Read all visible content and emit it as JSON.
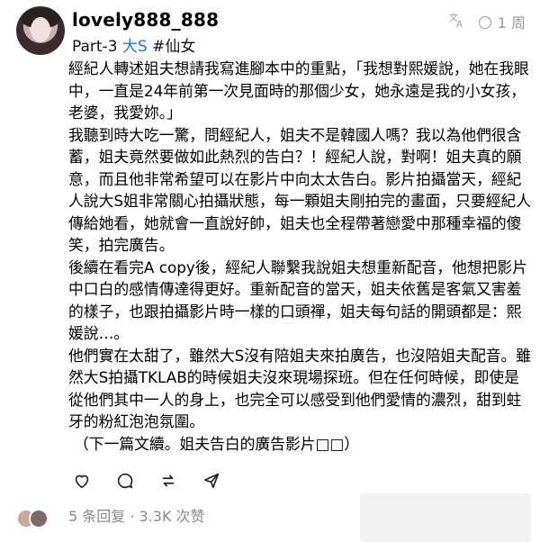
{
  "post": {
    "username": "lovely888_888",
    "part": "Part-3",
    "mention": "大S",
    "hashtag": "#仙女",
    "time": "1 周",
    "paragraphs": [
      "經紀人轉述姐夫想請我寫進腳本中的重點，「我想對熙媛說，她在我眼中，一直是24年前第一次見面時的那個少女，她永遠是我的小女孩，老婆，我愛妳。」",
      "我聽到時大吃一驚，問經紀人，姐夫不是韓國人嗎？我以為他們很含蓄，姐夫竟然要做如此熱烈的告白？！經紀人說，對啊！姐夫真的願意，而且他非常希望可以在影片中向太太告白。影片拍攝當天，經紀人說大S姐非常關心拍攝狀態，每一顆姐夫剛拍完的畫面，只要經紀人傳給她看，她就會一直說好帥，姐夫也全程帶著戀愛中那種幸福的傻笑，拍完廣告。",
      "後續在看完A copy後，經紀人聯繫我說姐夫想重新配音，他想把影片中口白的感情傳達得更好。重新配音的當天，姐夫依舊是客氣又害羞的樣子，也跟拍攝影片時一樣的口頭禪，姐夫每句話的開頭都是：熙媛說…。",
      "他們實在太甜了，雖然大S沒有陪姐夫來拍廣告，也沒陪姐夫配音。雖然大S拍攝TKLAB的時候姐夫沒來現場探班。但在任何時候，即使是從他們其中一人的身上，也完全可以感受到他們愛情的濃烈，甜到蛀牙的粉紅泡泡氛圍。",
      "（下一篇文續。姐夫告白的廣告影片□□）"
    ],
    "stats": "5 条回复 · 3.3K 次赞"
  },
  "icons": {
    "like": "heart-icon",
    "comment": "comment-icon",
    "repost": "repost-icon",
    "share": "share-icon",
    "translate": "translate-icon",
    "clock": "clock-icon"
  },
  "colors": {
    "mention": "#1c7ad8",
    "muted": "#9a9a9a"
  }
}
